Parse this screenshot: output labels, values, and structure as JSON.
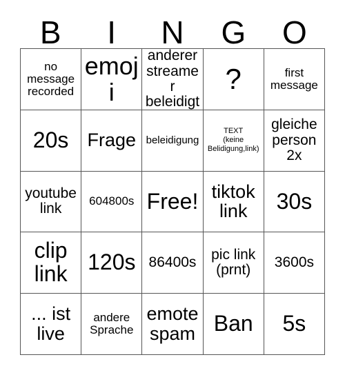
{
  "header": {
    "letters": [
      "B",
      "I",
      "N",
      "G",
      "O"
    ]
  },
  "grid": {
    "rows": 5,
    "columns": 5,
    "border_color": "#555555",
    "background_color": "#ffffff",
    "text_color": "#000000",
    "cells": [
      {
        "text": "no\nmessage\nrecorded",
        "size": "s"
      },
      {
        "text": "emoji",
        "size": "xxl"
      },
      {
        "text": "anderer\nstreamer\nbeleidigt",
        "size": "m"
      },
      {
        "text": "?",
        "size": "q"
      },
      {
        "text": "first\nmessage",
        "size": "s"
      },
      {
        "text": "20s",
        "size": "xl"
      },
      {
        "text": "Frage",
        "size": "l"
      },
      {
        "text": "beleidigung",
        "size": "xs"
      },
      {
        "text": "TEXT\n(keine\nBelidigung,link)",
        "size": "xxs"
      },
      {
        "text": "gleiche\nperson\n2x",
        "size": "m"
      },
      {
        "text": "youtube\nlink",
        "size": "m"
      },
      {
        "text": "604800s",
        "size": "s"
      },
      {
        "text": "Free!",
        "size": "xl"
      },
      {
        "text": "tiktok\nlink",
        "size": "l"
      },
      {
        "text": "30s",
        "size": "xl"
      },
      {
        "text": "clip\nlink",
        "size": "xl"
      },
      {
        "text": "120s",
        "size": "xl"
      },
      {
        "text": "86400s",
        "size": "m"
      },
      {
        "text": "pic link\n(prnt)",
        "size": "m"
      },
      {
        "text": "3600s",
        "size": "m"
      },
      {
        "text": "... ist\nlive",
        "size": "l"
      },
      {
        "text": "andere\nSprache",
        "size": "s"
      },
      {
        "text": "emote\nspam",
        "size": "l"
      },
      {
        "text": "Ban",
        "size": "xl"
      },
      {
        "text": "5s",
        "size": "xl"
      }
    ]
  }
}
